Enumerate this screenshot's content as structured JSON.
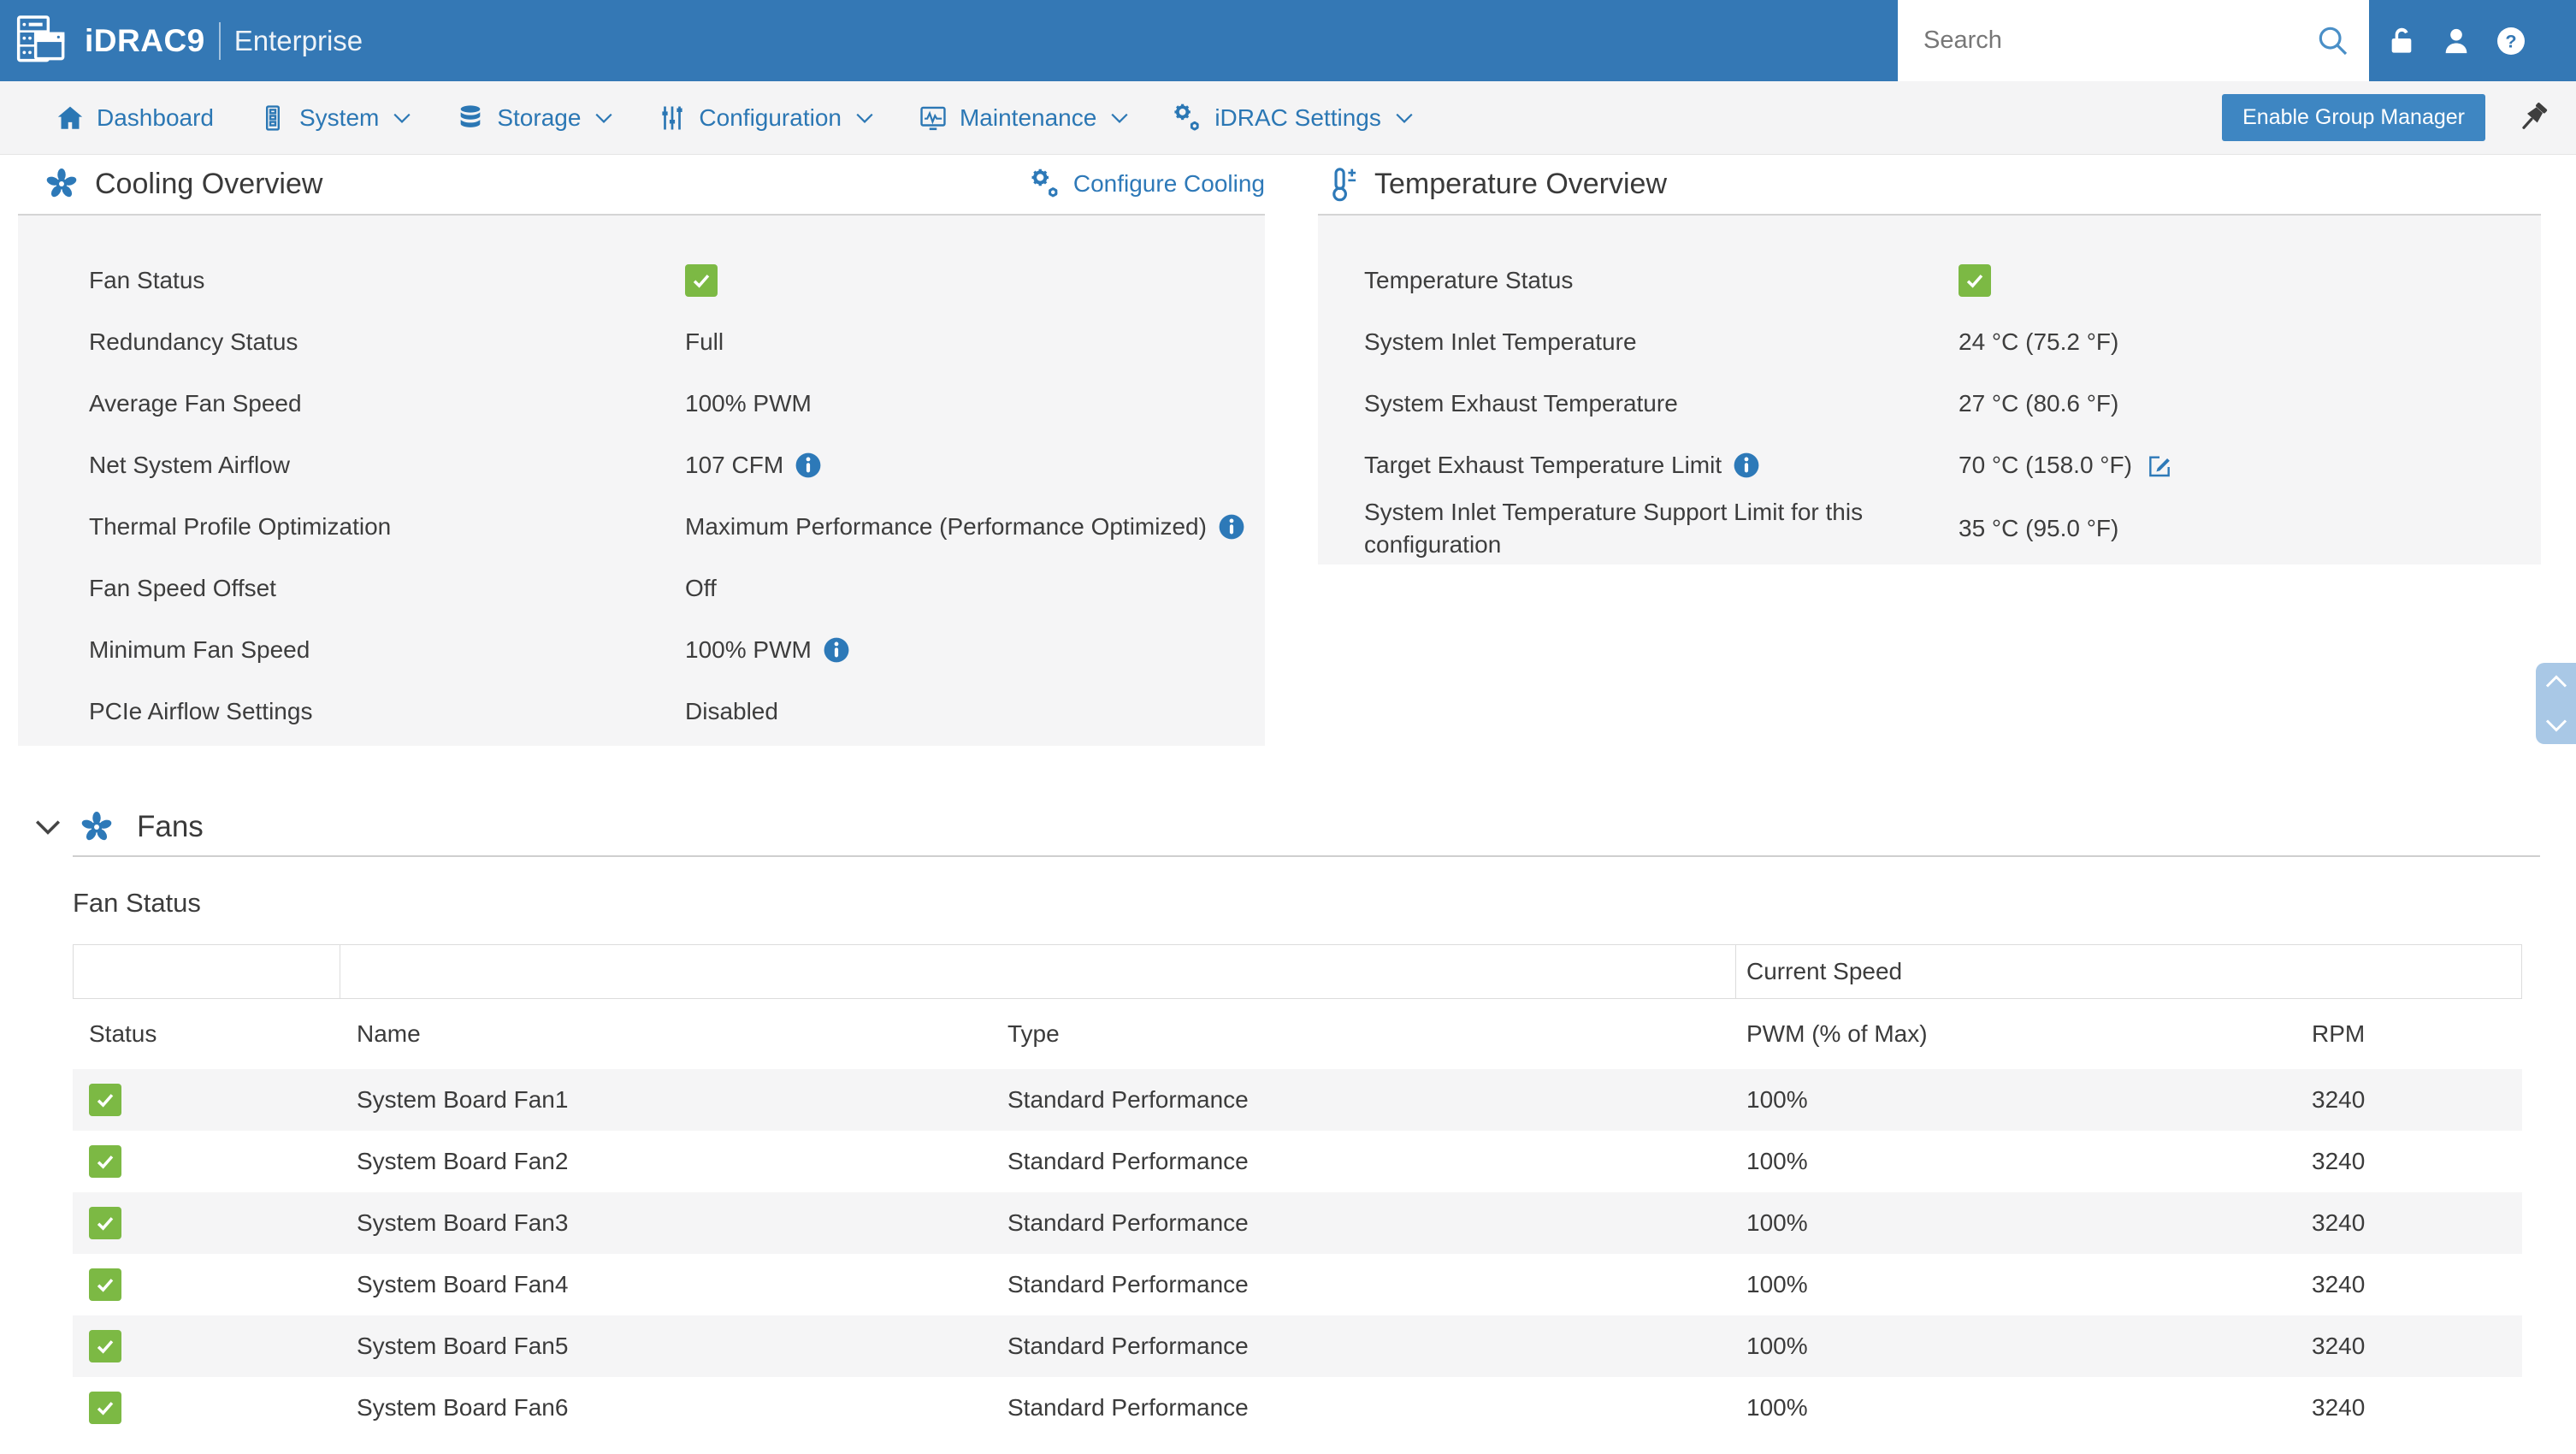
{
  "header": {
    "brand": "iDRAC9",
    "edition": "Enterprise",
    "search_placeholder": "Search"
  },
  "nav": {
    "items": [
      {
        "label": "Dashboard",
        "icon": "home-icon",
        "dropdown": false
      },
      {
        "label": "System",
        "icon": "system-icon",
        "dropdown": true
      },
      {
        "label": "Storage",
        "icon": "storage-icon",
        "dropdown": true
      },
      {
        "label": "Configuration",
        "icon": "configuration-icon",
        "dropdown": true
      },
      {
        "label": "Maintenance",
        "icon": "maintenance-icon",
        "dropdown": true
      },
      {
        "label": "iDRAC Settings",
        "icon": "settings-gears-icon",
        "dropdown": true
      }
    ],
    "group_manager_button": "Enable Group Manager"
  },
  "cooling": {
    "title": "Cooling Overview",
    "configure_link": "Configure Cooling",
    "rows": [
      {
        "label": "Fan Status",
        "status_ok": true
      },
      {
        "label": "Redundancy Status",
        "value": "Full"
      },
      {
        "label": "Average Fan Speed",
        "value": "100% PWM"
      },
      {
        "label": "Net System Airflow",
        "value": "107 CFM",
        "info": true
      },
      {
        "label": "Thermal Profile Optimization",
        "value": "Maximum Performance (Performance Optimized)",
        "info": true
      },
      {
        "label": "Fan Speed Offset",
        "value": "Off"
      },
      {
        "label": "Minimum Fan Speed",
        "value": "100% PWM",
        "info": true
      },
      {
        "label": "PCIe Airflow Settings",
        "value": "Disabled"
      }
    ]
  },
  "temperature": {
    "title": "Temperature Overview",
    "rows": [
      {
        "label": "Temperature Status",
        "status_ok": true
      },
      {
        "label": "System Inlet Temperature",
        "value": "24 °C (75.2 °F)"
      },
      {
        "label": "System Exhaust Temperature",
        "value": "27 °C (80.6 °F)"
      },
      {
        "label": "Target Exhaust Temperature Limit",
        "value": "70 °C (158.0 °F)",
        "label_info": true,
        "editable": true
      },
      {
        "label": "System Inlet Temperature Support Limit for this configuration",
        "value": "35 °C (95.0 °F)"
      }
    ]
  },
  "fans": {
    "section_title": "Fans",
    "table_title": "Fan Status",
    "table": {
      "group_header": "Current Speed",
      "columns": [
        "Status",
        "Name",
        "Type",
        "PWM (% of Max)",
        "RPM"
      ],
      "rows": [
        {
          "status_ok": true,
          "name": "System Board Fan1",
          "type": "Standard Performance",
          "pwm": "100%",
          "rpm": "3240"
        },
        {
          "status_ok": true,
          "name": "System Board Fan2",
          "type": "Standard Performance",
          "pwm": "100%",
          "rpm": "3240"
        },
        {
          "status_ok": true,
          "name": "System Board Fan3",
          "type": "Standard Performance",
          "pwm": "100%",
          "rpm": "3240"
        },
        {
          "status_ok": true,
          "name": "System Board Fan4",
          "type": "Standard Performance",
          "pwm": "100%",
          "rpm": "3240"
        },
        {
          "status_ok": true,
          "name": "System Board Fan5",
          "type": "Standard Performance",
          "pwm": "100%",
          "rpm": "3240"
        },
        {
          "status_ok": true,
          "name": "System Board Fan6",
          "type": "Standard Performance",
          "pwm": "100%",
          "rpm": "3240"
        }
      ]
    }
  },
  "colors": {
    "header_blue": "#3478b5",
    "link_blue": "#2e79b8",
    "nav_blue": "#2b77b4",
    "button_blue": "#3e86c2",
    "status_green": "#7cb944",
    "panel_gray": "#f5f5f6",
    "scroll_widget_blue": "#a9c8e6"
  }
}
